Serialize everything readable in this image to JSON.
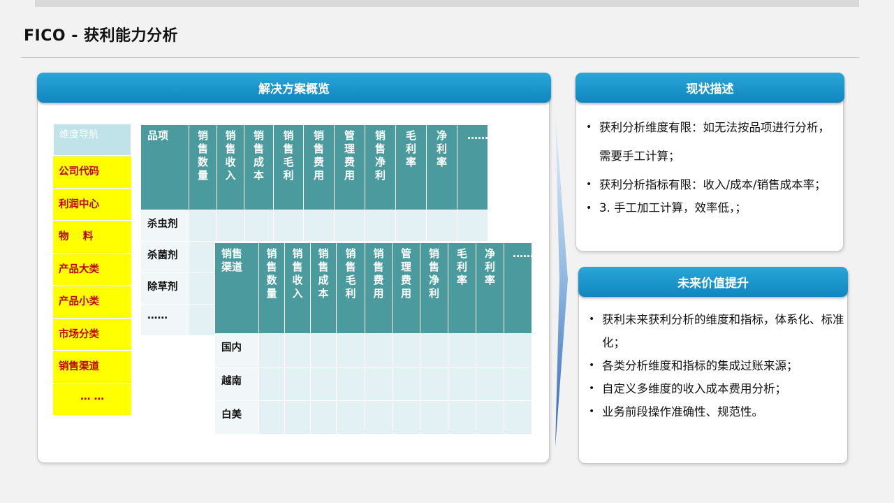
{
  "page": {
    "title": "FICO - 获利能力分析"
  },
  "left_panel": {
    "header": "解决方案概览"
  },
  "dimension_nav": {
    "header": "维度导航",
    "items": [
      "公司代码",
      "利润中心",
      "物    料",
      "产品大类",
      "产品小类",
      "市场分类",
      "销售渠道",
      "… …"
    ]
  },
  "product_table": {
    "columns": [
      "品项",
      "销售数量",
      "销售收入",
      "销售成本",
      "销售毛利",
      "销售费用",
      "管理费用",
      "销售净利",
      "毛利率",
      "净利率",
      "……"
    ],
    "rows": [
      "杀虫剂",
      "杀菌剂",
      "除草剂",
      "……"
    ]
  },
  "channel_table": {
    "columns": [
      "销售渠道",
      "销售数量",
      "销售收入",
      "销售成本",
      "销售毛利",
      "销售费用",
      "管理费用",
      "销售净利",
      "毛利率",
      "净利率",
      "……"
    ],
    "rows": [
      "国内",
      "越南",
      "白美"
    ]
  },
  "status_panel": {
    "header": "现状描述",
    "items": [
      "获利分析维度有限：如无法按品项进行分析，需要手工计算；",
      "获利分析指标有限：收入/成本/销售成本率；",
      "3. 手工加工计算，效率低，；"
    ]
  },
  "future_panel": {
    "header": "未来价值提升",
    "items": [
      "获利未来获利分析的维度和指标，体系化、标准化；",
      "各类分析维度和指标的集成过账来源；",
      "自定义多维度的收入成本费用分析；",
      "业务前段操作准确性、规范性。"
    ]
  },
  "colors": {
    "header_blue": "#0f86bf",
    "table_header": "#4a9a9e",
    "nav_highlight": "#ffff00",
    "nav_text": "#c00000"
  }
}
